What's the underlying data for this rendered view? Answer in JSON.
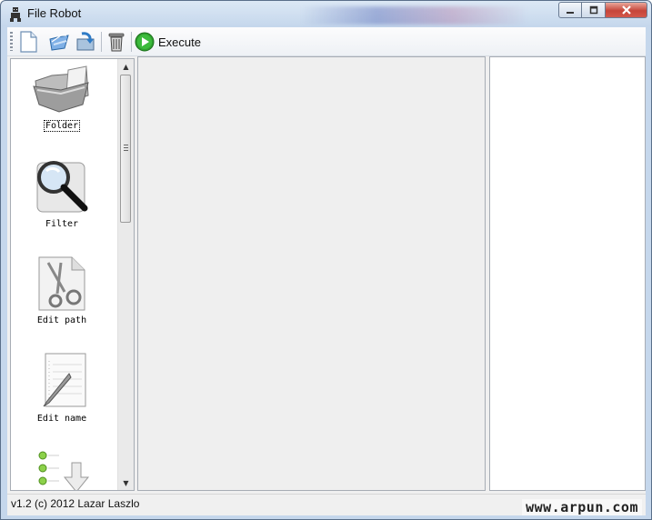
{
  "window": {
    "title": "File Robot",
    "controls": {
      "minimize": "minimize",
      "maximize": "maximize",
      "close": "close"
    }
  },
  "toolbar": {
    "items": [
      {
        "icon": "new-document-icon"
      },
      {
        "icon": "open-icon"
      },
      {
        "icon": "save-icon"
      },
      {
        "icon": "trash-icon"
      }
    ],
    "execute_label": "Execute"
  },
  "toolbox": {
    "items": [
      {
        "label": "Folder",
        "icon": "folder-icon",
        "focused": true
      },
      {
        "label": "Filter",
        "icon": "magnifier-icon"
      },
      {
        "label": "Edit path",
        "icon": "scissors-icon"
      },
      {
        "label": "Edit name",
        "icon": "notepad-pen-icon"
      },
      {
        "label": "",
        "icon": "list-arrow-icon"
      }
    ]
  },
  "status": {
    "text": "v1.2 (c) 2012 Lazar Laszlo",
    "watermark": "www.arpun.com"
  },
  "colors": {
    "title_bar": "#c5d7ec",
    "close_button": "#c6453a",
    "execute_icon": "#2fa12f",
    "panel_background": "#efefef"
  }
}
